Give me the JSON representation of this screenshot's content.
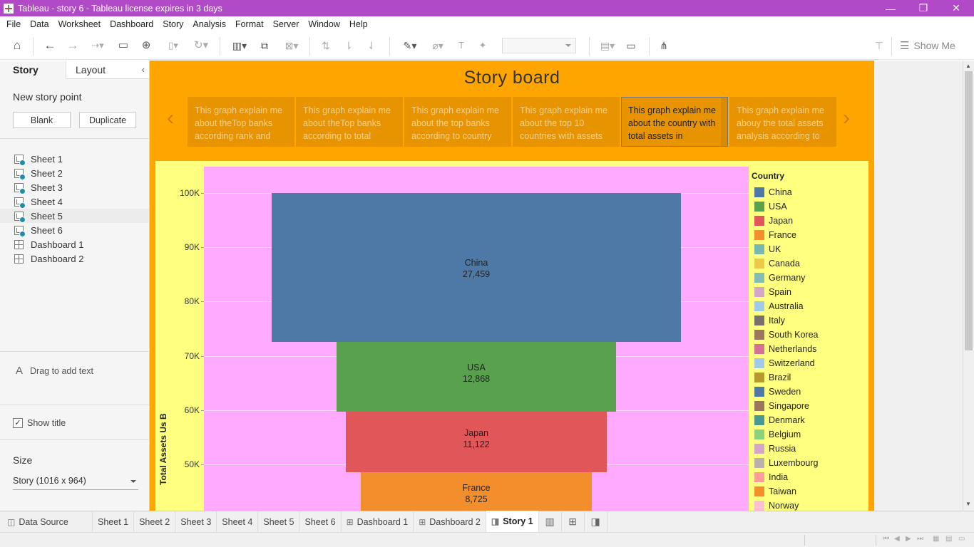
{
  "window": {
    "title": "Tableau - story 6 - Tableau license expires in 3 days",
    "minimize": "—",
    "restore": "❐",
    "close": "✕"
  },
  "menu": [
    "File",
    "Data",
    "Worksheet",
    "Dashboard",
    "Story",
    "Analysis",
    "Format",
    "Server",
    "Window",
    "Help"
  ],
  "toolbar": {
    "show_me": "Show Me"
  },
  "left_panel": {
    "tabs": {
      "story": "Story",
      "layout": "Layout"
    },
    "new_story_point": "New story point",
    "blank_button": "Blank",
    "duplicate_button": "Duplicate",
    "sheets": [
      {
        "label": "Sheet 1",
        "kind": "worksheet"
      },
      {
        "label": "Sheet 2",
        "kind": "worksheet"
      },
      {
        "label": "Sheet 3",
        "kind": "worksheet"
      },
      {
        "label": "Sheet 4",
        "kind": "worksheet"
      },
      {
        "label": "Sheet 5",
        "kind": "worksheet"
      },
      {
        "label": "Sheet 6",
        "kind": "worksheet"
      },
      {
        "label": "Dashboard 1",
        "kind": "dashboard"
      },
      {
        "label": "Dashboard 2",
        "kind": "dashboard"
      }
    ],
    "drag_text": "Drag to add text",
    "show_title": "Show title",
    "show_title_checked": true,
    "size_label": "Size",
    "size_value": "Story (1016 x 964)"
  },
  "story": {
    "title": "Story board",
    "captions": [
      "This graph explain me about theTop banks according rank and",
      "This graph explain me about theTop banks according to total",
      "This graph explain me about the top banks according to country",
      "This graph explain me about the top 10 countries with assets",
      "This graph explain me about the country with total assets in",
      "This graph explain me abouy the total assets analysis according to"
    ],
    "active_caption": 4,
    "background_color": "#ffa500",
    "plot_background": "#ffff80",
    "pane_background": "#ffaaff"
  },
  "chart_data": {
    "type": "bar",
    "ylabel": "Total Assets Us B",
    "yticks": [
      "100K",
      "90K",
      "80K",
      "70K",
      "60K",
      "50K"
    ],
    "ylim": [
      45000,
      104000
    ],
    "series_note": "stacked funnel; each segment height equals value",
    "segments": [
      {
        "name": "China",
        "value": 27459,
        "value_label": "27,459",
        "color": "#4e79a7"
      },
      {
        "name": "USA",
        "value": 12868,
        "value_label": "12,868",
        "color": "#59a14f"
      },
      {
        "name": "Japan",
        "value": 11122,
        "value_label": "11,122",
        "color": "#e15759"
      },
      {
        "name": "France",
        "value": 8725,
        "value_label": "8,725",
        "color": "#f28e2b"
      }
    ],
    "top_value": 100000,
    "legend_title": "Country",
    "legend": [
      {
        "name": "China",
        "color": "#4e79a7"
      },
      {
        "name": "USA",
        "color": "#59a14f"
      },
      {
        "name": "Japan",
        "color": "#e15759"
      },
      {
        "name": "France",
        "color": "#f28e2b"
      },
      {
        "name": "UK",
        "color": "#76b7b2"
      },
      {
        "name": "Canada",
        "color": "#edc948"
      },
      {
        "name": "Germany",
        "color": "#86bcb6"
      },
      {
        "name": "Spain",
        "color": "#d4a6c8"
      },
      {
        "name": "Australia",
        "color": "#a0cbe8"
      },
      {
        "name": "Italy",
        "color": "#79706e"
      },
      {
        "name": "South Korea",
        "color": "#9d7660"
      },
      {
        "name": "Netherlands",
        "color": "#d37295"
      },
      {
        "name": "Switzerland",
        "color": "#a0cbe8"
      },
      {
        "name": "Brazil",
        "color": "#b6992d"
      },
      {
        "name": "Sweden",
        "color": "#4e79a7"
      },
      {
        "name": "Singapore",
        "color": "#9c755f"
      },
      {
        "name": "Denmark",
        "color": "#499894"
      },
      {
        "name": "Belgium",
        "color": "#8cd17d"
      },
      {
        "name": "Russia",
        "color": "#d4a6c8"
      },
      {
        "name": "Luxembourg",
        "color": "#bab0ac"
      },
      {
        "name": "India",
        "color": "#ff9d9a"
      },
      {
        "name": "Taiwan",
        "color": "#f28e2b"
      },
      {
        "name": "Norway",
        "color": "#fabfd2"
      }
    ]
  },
  "bottom_tabs": [
    {
      "label": "Data Source",
      "icon": "datasource"
    },
    {
      "label": "Sheet 1",
      "icon": "none"
    },
    {
      "label": "Sheet 2",
      "icon": "none"
    },
    {
      "label": "Sheet 3",
      "icon": "none"
    },
    {
      "label": "Sheet 4",
      "icon": "none"
    },
    {
      "label": "Sheet 5",
      "icon": "none"
    },
    {
      "label": "Sheet 6",
      "icon": "none"
    },
    {
      "label": "Dashboard 1",
      "icon": "dashboard"
    },
    {
      "label": "Dashboard 2",
      "icon": "dashboard"
    },
    {
      "label": "Story 1",
      "icon": "story",
      "active": true
    }
  ]
}
